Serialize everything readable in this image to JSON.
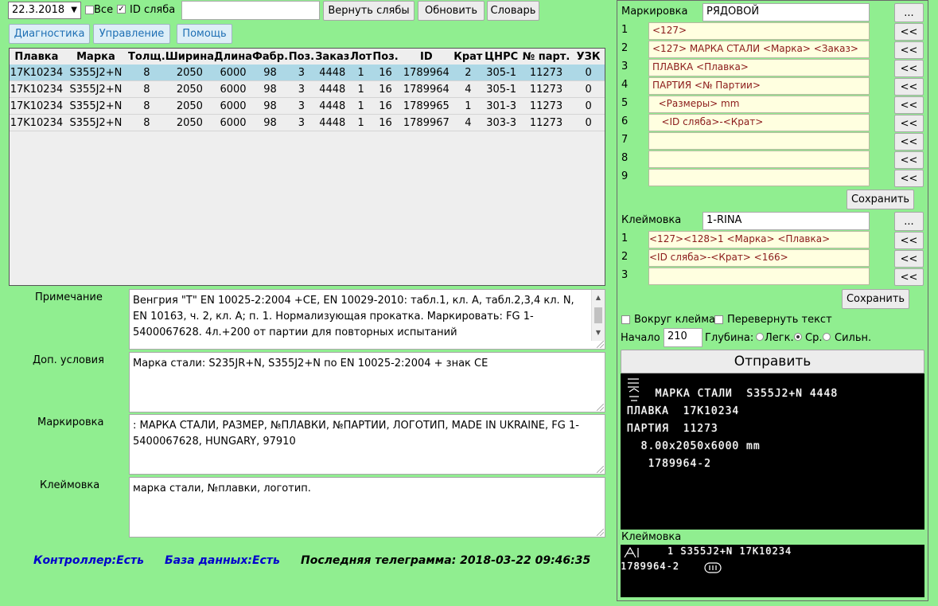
{
  "toolbar": {
    "date": "22.3.2018",
    "all_label": "Все",
    "id_label": "ID сляба",
    "id_value": "",
    "return_label": "Вернуть слябы",
    "refresh_label": "Обновить",
    "dict_label": "Словарь"
  },
  "nav": {
    "diag": "Диагностика",
    "control": "Управление",
    "help": "Помощь"
  },
  "table": {
    "headers": [
      "Плавка",
      "Марка",
      "Толщ.",
      "Ширина",
      "Длина",
      "Фабр.",
      "Поз.",
      "Заказ",
      "Лот",
      "Поз.",
      "ID",
      "Крат",
      "ЦНРС",
      "№ парт.",
      "УЗК"
    ],
    "rows": [
      [
        "17K10234",
        "S355J2+N",
        "8",
        "2050",
        "6000",
        "98",
        "3",
        "4448",
        "1",
        "16",
        "1789964",
        "2",
        "305-1",
        "11273",
        "0"
      ],
      [
        "17K10234",
        "S355J2+N",
        "8",
        "2050",
        "6000",
        "98",
        "3",
        "4448",
        "1",
        "16",
        "1789964",
        "4",
        "305-1",
        "11273",
        "0"
      ],
      [
        "17K10234",
        "S355J2+N",
        "8",
        "2050",
        "6000",
        "98",
        "3",
        "4448",
        "1",
        "16",
        "1789965",
        "1",
        "301-3",
        "11273",
        "0"
      ],
      [
        "17K10234",
        "S355J2+N",
        "8",
        "2050",
        "6000",
        "98",
        "3",
        "4448",
        "1",
        "16",
        "1789967",
        "4",
        "303-3",
        "11273",
        "0"
      ]
    ]
  },
  "notes": {
    "note_label": "Примечание",
    "note_text": "Венгрия  \"T\" EN 10025-2:2004 +CE, EN 10029-2010:  табл.1, кл. A, табл.2,3,4 кл. N, EN 10163, ч. 2, кл. A; п. 1. Нормализующая прокатка. Маркировать: FG 1-5400067628.  4л.+200 от партии для повторных испытаний",
    "cond_label": "Доп. условия",
    "cond_text": "Марка стали: S235JR+N, S355J2+N по EN 10025-2:2004 + знак CE",
    "mark_label": "Маркировка",
    "mark_text": ": МАРКА СТАЛИ, РАЗМЕР, №ПЛАВКИ, №ПАРТИИ, ЛОГОТИП, MADE IN UKRAINE, FG 1-5400067628, HUNGARY, 97910",
    "stamp_label": "Клеймовка",
    "stamp_text": "марка стали, №плавки, логотип."
  },
  "status": {
    "controller": "Контроллер:Есть",
    "db": "База данных:Есть",
    "telegram": "Последняя телеграмма: 2018-03-22 09:46:35"
  },
  "marking": {
    "label": "Маркировка",
    "template": "РЯДОВОЙ",
    "dots": "...",
    "arrow": "<<",
    "lines": [
      {
        "n": "1",
        "v": "<127>"
      },
      {
        "n": "2",
        "v": "<127> МАРКА СТАЛИ <Марка> <Заказ>"
      },
      {
        "n": "3",
        "v": "ПЛАВКА <Плавка>"
      },
      {
        "n": "4",
        "v": "ПАРТИЯ <№ Партии>"
      },
      {
        "n": "5",
        "v": "  <Размеры> mm"
      },
      {
        "n": "6",
        "v": "   <ID сляба>-<Крат>"
      },
      {
        "n": "7",
        "v": ""
      },
      {
        "n": "8",
        "v": ""
      },
      {
        "n": "9",
        "v": ""
      }
    ],
    "save": "Сохранить"
  },
  "stamping": {
    "label": "Клеймовка",
    "template": "1-RINA",
    "lines": [
      {
        "n": "1",
        "v": "<127><128>1 <Марка> <Плавка>"
      },
      {
        "n": "2",
        "v": "<ID сляба>-<Крат> <166>"
      },
      {
        "n": "3",
        "v": ""
      }
    ],
    "save": "Сохранить"
  },
  "options": {
    "around": "Вокруг клейма",
    "flip": "Перевернуть текст",
    "start_label": "Начало",
    "start_value": "210",
    "depth_label": "Глубина:",
    "light": "Легк.",
    "medium": "Ср.",
    "strong": "Сильн.",
    "send": "Отправить"
  },
  "preview": {
    "mark_lines": [
      "  МАРКА СТАЛИ  S355J2+N 4448",
      "ПЛАВКА  17K10234",
      "ПАРТИЯ  11273",
      "  8.00x2050x6000 mm",
      "   1789964-2"
    ],
    "stamp_label": "Клеймовка",
    "stamp_lines": [
      "    1 S355J2+N 17K10234",
      "1789964-2"
    ]
  }
}
